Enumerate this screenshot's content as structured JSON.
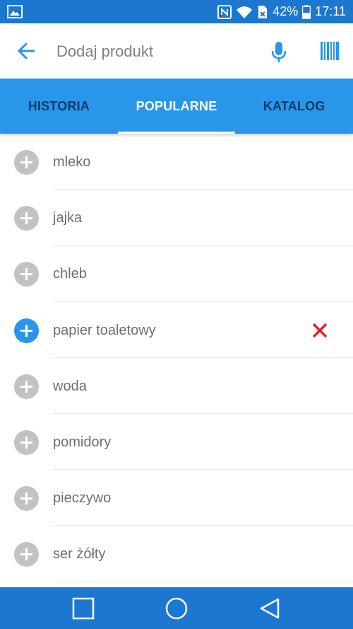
{
  "status_bar": {
    "battery": "42%",
    "time": "17:11",
    "icons": [
      "image-notification-icon",
      "nfc-icon",
      "wifi-icon",
      "no-sim-icon",
      "battery-icon"
    ]
  },
  "search": {
    "placeholder": "Dodaj produkt",
    "value": "",
    "icons": [
      "back-arrow-icon",
      "microphone-icon",
      "barcode-icon"
    ]
  },
  "tabs": [
    {
      "label": "HISTORIA",
      "active": false
    },
    {
      "label": "POPULARNE",
      "active": true
    },
    {
      "label": "KATALOG",
      "active": false
    }
  ],
  "products": [
    {
      "name": "mleko",
      "added": false
    },
    {
      "name": "jajka",
      "added": false
    },
    {
      "name": "chleb",
      "added": false
    },
    {
      "name": "papier toaletowy",
      "added": true
    },
    {
      "name": "woda",
      "added": false
    },
    {
      "name": "pomidory",
      "added": false
    },
    {
      "name": "pieczywo",
      "added": false
    },
    {
      "name": "ser żółty",
      "added": false
    }
  ],
  "colors": {
    "status_bar": "#1b77cf",
    "tab_bar": "#2996ea",
    "accent": "#2996ea",
    "inactive_tab_text": "#0d3a66",
    "add_inactive": "#c2c2c2",
    "remove": "#e8141c"
  },
  "nav": {
    "icons": [
      "recent-apps-icon",
      "home-icon",
      "back-icon"
    ]
  }
}
